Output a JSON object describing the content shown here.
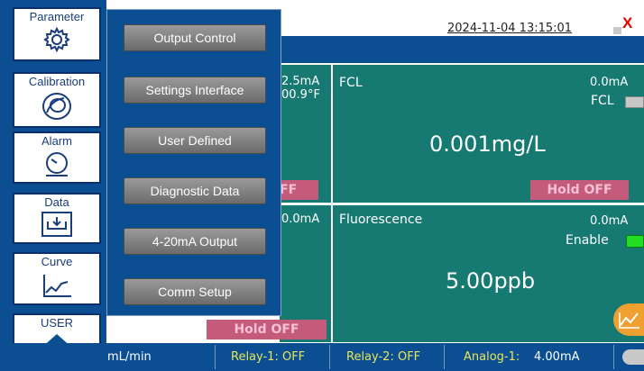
{
  "header": {
    "datetime": "2024-11-04 13:15:01",
    "close_glyph": "X"
  },
  "sidebar": {
    "items": [
      {
        "label": "Parameter",
        "icon": "gear-icon"
      },
      {
        "label": "Calibration",
        "icon": "disc-icon"
      },
      {
        "label": "Alarm",
        "icon": "alarm-icon"
      },
      {
        "label": "Data",
        "icon": "data-tray-icon"
      },
      {
        "label": "Curve",
        "icon": "curve-icon"
      },
      {
        "label": "USER",
        "icon": "home-icon"
      }
    ]
  },
  "menu": {
    "items": [
      "Output Control",
      "Settings Interface",
      "User Defined",
      "Diagnostic Data",
      "4-20mA Output",
      "Comm Setup"
    ]
  },
  "panels": {
    "top_left": {
      "current": "2.5mA",
      "temp": "00.9°F",
      "hold_partial": "FF"
    },
    "fcl": {
      "title": "FCL",
      "current": "0.0mA",
      "toggle_label": "FCL",
      "value": "0.001mg/L",
      "hold": "Hold OFF"
    },
    "bottom_left": {
      "current": "0.0mA",
      "hold": "Hold OFF"
    },
    "fluorescence": {
      "title": "Fluorescence",
      "current": "0.0mA",
      "toggle_label": "Enable",
      "value": "5.00ppb"
    }
  },
  "bottom": {
    "flow": "mL/min",
    "relay1": "Relay-1: OFF",
    "relay2": "Relay-2: OFF",
    "analog_label": "Analog-1:",
    "analog_value": "4.00mA"
  },
  "colors": {
    "blue": "#0b4f92",
    "teal": "#167a73",
    "hold_pink": "#c45b7b",
    "relay_yellow": "#e6e65a",
    "enable_green": "#22dd22",
    "close_red": "#e00000"
  }
}
